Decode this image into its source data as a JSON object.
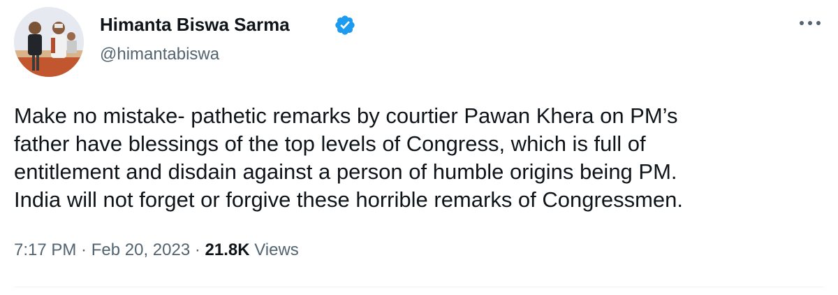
{
  "author": {
    "display_name": "Himanta Biswa Sarma",
    "handle": "@himantabiswa",
    "verified": true
  },
  "tweet": {
    "lines": [
      "Make no mistake- pathetic remarks by courtier Pawan Khera on PM’s",
      "father have blessings of the top levels of Congress, which is full of",
      "entitlement and disdain against a person of humble origins being PM.",
      "India will not forget or forgive these horrible remarks of Congressmen."
    ]
  },
  "meta": {
    "time": "7:17 PM",
    "separator": " · ",
    "date": "Feb 20, 2023",
    "views_count": "21.8K",
    "views_label": " Views"
  },
  "icons": {
    "verified": "verified-badge-icon",
    "more": "more-options-icon"
  },
  "colors": {
    "primary_text": "#0f1419",
    "secondary_text": "#536471",
    "verified_blue": "#1d9bf0",
    "divider": "#eff3f4"
  }
}
